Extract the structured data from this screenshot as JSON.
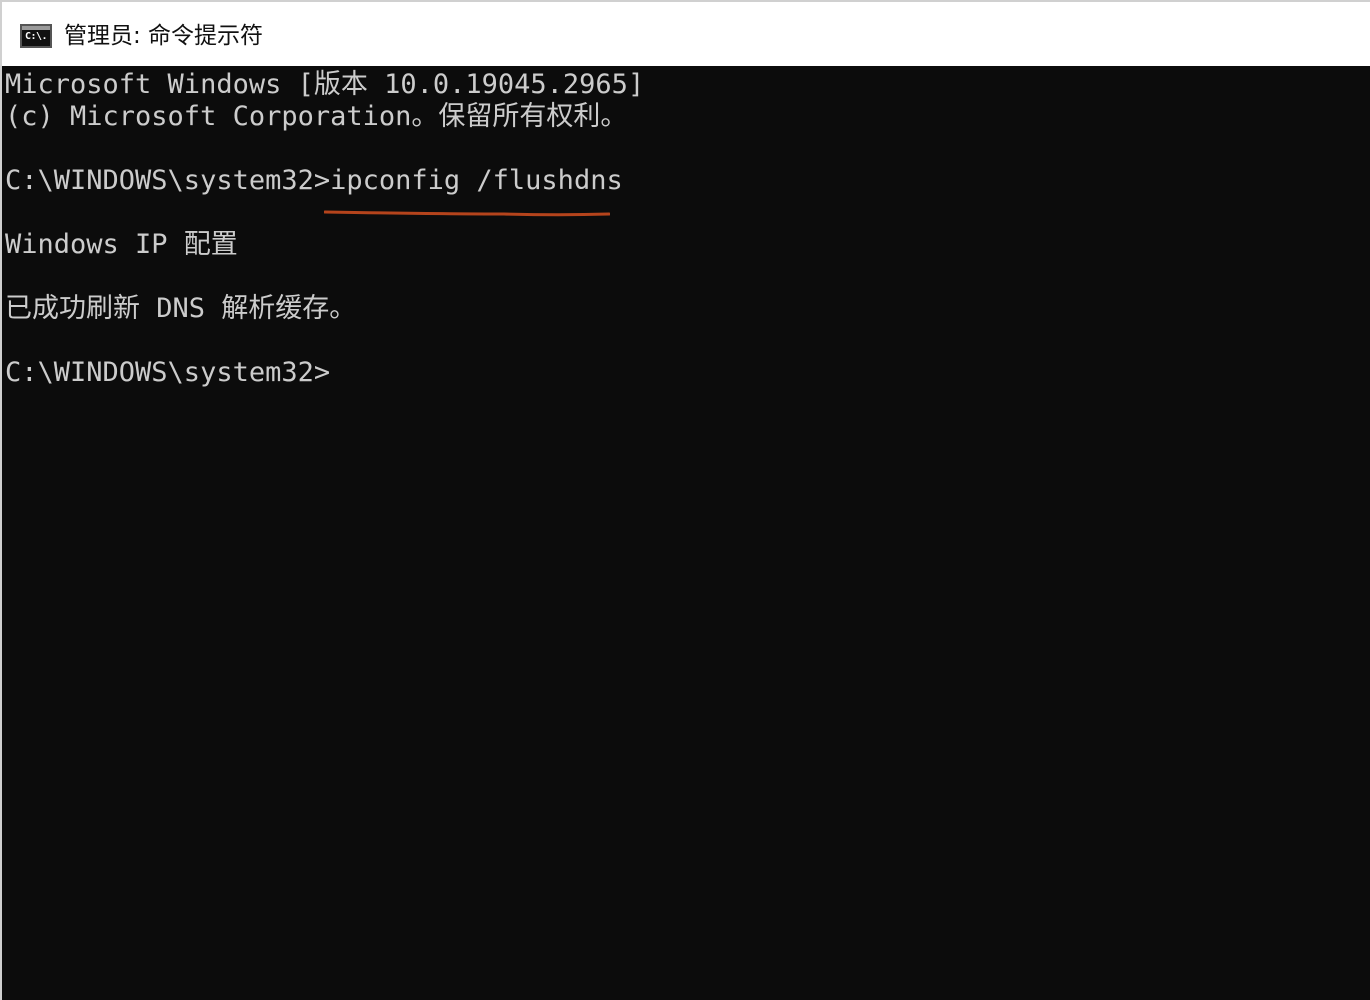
{
  "window": {
    "title": "管理员: 命令提示符",
    "icon": "console-icon",
    "icon_text": "C:\\."
  },
  "console": {
    "lines": [
      "Microsoft Windows [版本 10.0.19045.2965]",
      "(c) Microsoft Corporation。保留所有权利。",
      "",
      "C:\\WINDOWS\\system32>ipconfig /flushdns",
      "",
      "Windows IP 配置",
      "",
      "已成功刷新 DNS 解析缓存。",
      "",
      "C:\\WINDOWS\\system32>"
    ],
    "highlighted_command": "ipconfig /flushdns",
    "annotation_color": "#b5441c",
    "background_color": "#0c0c0c",
    "text_color": "#cccccc"
  }
}
